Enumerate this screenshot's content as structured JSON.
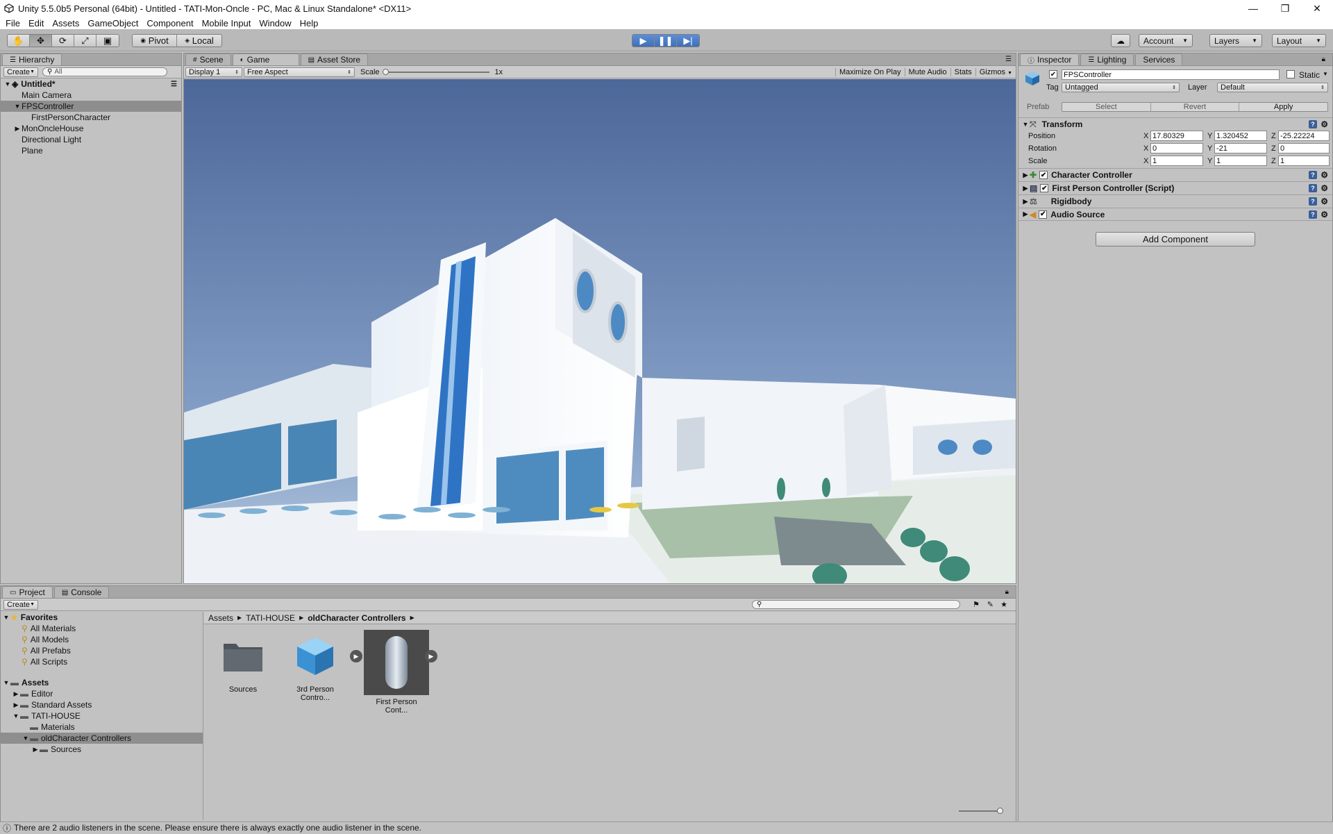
{
  "window": {
    "title": "Unity 5.5.0b5 Personal (64bit) - Untitled - TATI-Mon-Oncle - PC, Mac & Linux Standalone* <DX11>",
    "minimize": "—",
    "restore": "❐",
    "close": "✕"
  },
  "menu": [
    "File",
    "Edit",
    "Assets",
    "GameObject",
    "Component",
    "Mobile Input",
    "Window",
    "Help"
  ],
  "toolbar": {
    "pivot": "Pivot",
    "local": "Local",
    "account": "Account",
    "layers": "Layers",
    "layout": "Layout"
  },
  "hierarchy": {
    "tab": "Hierarchy",
    "create": "Create",
    "search_placeholder": "All",
    "scene": "Untitled*",
    "items": [
      "Main Camera",
      "FPSController",
      "FirstPersonCharacter",
      "MonOncleHouse",
      "Directional Light",
      "Plane"
    ]
  },
  "center": {
    "tabs": [
      "Scene",
      "Game",
      "Asset Store"
    ],
    "display": "Display 1",
    "aspect": "Free Aspect",
    "scale_label": "Scale",
    "scale_value": "1x",
    "buttons": [
      "Maximize On Play",
      "Mute Audio",
      "Stats",
      "Gizmos"
    ]
  },
  "inspector": {
    "tabs": [
      "Inspector",
      "Lighting",
      "Services"
    ],
    "object_name": "FPSController",
    "static_label": "Static",
    "tag_label": "Tag",
    "tag_value": "Untagged",
    "layer_label": "Layer",
    "layer_value": "Default",
    "prefab_label": "Prefab",
    "prefab_select": "Select",
    "prefab_revert": "Revert",
    "prefab_apply": "Apply",
    "transform": {
      "title": "Transform",
      "position": {
        "label": "Position",
        "x": "17.80329",
        "y": "1.320452",
        "z": "-25.22224"
      },
      "rotation": {
        "label": "Rotation",
        "x": "0",
        "y": "-21",
        "z": "0"
      },
      "scale": {
        "label": "Scale",
        "x": "1",
        "y": "1",
        "z": "1"
      }
    },
    "components": [
      "Character Controller",
      "First Person Controller (Script)",
      "Rigidbody",
      "Audio Source"
    ],
    "add_component": "Add Component"
  },
  "project": {
    "tabs": [
      "Project",
      "Console"
    ],
    "create": "Create",
    "favorites_title": "Favorites",
    "favorites": [
      "All Materials",
      "All Models",
      "All Prefabs",
      "All Scripts"
    ],
    "assets_title": "Assets",
    "tree": [
      "Editor",
      "Standard Assets",
      "TATI-HOUSE",
      "Materials",
      "oldCharacter Controllers",
      "Sources"
    ],
    "breadcrumb": [
      "Assets",
      "TATI-HOUSE",
      "oldCharacter Controllers"
    ],
    "assets": [
      "Sources",
      "3rd Person Contro...",
      "First Person Cont..."
    ]
  },
  "status": "There are 2 audio listeners in the scene. Please ensure there is always exactly one audio listener in the scene.",
  "colors": {
    "accent": "#3e6fb8",
    "selection": "#8e8e8e",
    "sky_top": "#4f6a9a",
    "sky_bottom": "#8ea8cc"
  }
}
